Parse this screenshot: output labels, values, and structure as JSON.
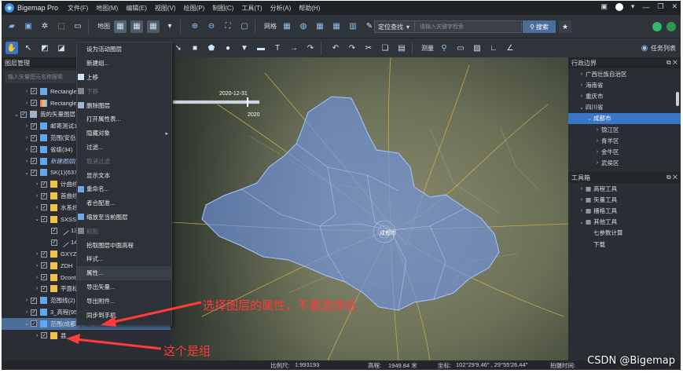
{
  "window": {
    "app_title": "Bigemap Pro",
    "menus": [
      "文件(F)",
      "地图(M)",
      "编辑(E)",
      "视图(V)",
      "绘图(P)",
      "制图(C)",
      "工具(T)",
      "分析(A)",
      "帮助(H)"
    ]
  },
  "toolbar": {
    "map_label": "地图",
    "grid_label": "网格",
    "search_mode": "定位查找",
    "search_placeholder": "请输入关键字检索",
    "search_button": "搜索",
    "measure_label": "测量",
    "task_list_label": "任务列表"
  },
  "layer_panel": {
    "title": "图层管理",
    "search_placeholder": "输入矢量图元名称搜索",
    "rows": [
      {
        "label": "Rectangle_",
        "indent": 1,
        "arrow": "›",
        "checked": true,
        "icon": "raster-icon"
      },
      {
        "label": "Rectangle_",
        "indent": 1,
        "arrow": "›",
        "checked": true,
        "icon": "raster-colored-icon"
      },
      {
        "label": "我的矢量图层",
        "indent": 0,
        "arrow": "⌄",
        "checked": true,
        "icon": "vector-group-icon"
      },
      {
        "label": "邮寄测试11",
        "indent": 1,
        "arrow": "›",
        "checked": true,
        "icon": "layer-stack-icon"
      },
      {
        "label": "范围(安岳县",
        "indent": 1,
        "arrow": "›",
        "checked": true,
        "icon": "layer-stack-icon"
      },
      {
        "label": "省级(34)",
        "indent": 1,
        "arrow": "›",
        "checked": true,
        "icon": "layer-stack-icon"
      },
      {
        "label": "新建图层(4)",
        "indent": 1,
        "arrow": "›",
        "checked": true,
        "icon": "layer-stack-icon",
        "italic": true
      },
      {
        "label": "SK(1)(637)",
        "indent": 1,
        "arrow": "⌄",
        "checked": true,
        "icon": "layer-stack-icon"
      },
      {
        "label": "计曲线",
        "indent": 2,
        "arrow": "›",
        "checked": true,
        "icon": "folder-icon"
      },
      {
        "label": "首曲线",
        "indent": 2,
        "arrow": "›",
        "checked": true,
        "icon": "folder-icon"
      },
      {
        "label": "水系线",
        "indent": 2,
        "arrow": "›",
        "checked": true,
        "icon": "folder-icon"
      },
      {
        "label": "SXSS",
        "indent": 2,
        "arrow": "⌄",
        "checked": true,
        "icon": "folder-icon"
      },
      {
        "label": "13",
        "indent": 3,
        "arrow": "",
        "checked": true,
        "icon": "line-icon"
      },
      {
        "label": "14",
        "indent": 3,
        "arrow": "",
        "checked": true,
        "icon": "line-icon"
      },
      {
        "label": "GXYZ",
        "indent": 2,
        "arrow": "›",
        "checked": true,
        "icon": "folder-icon"
      },
      {
        "label": "ZDH",
        "indent": 2,
        "arrow": "›",
        "checked": true,
        "icon": "folder-icon"
      },
      {
        "label": "Dconto",
        "indent": 2,
        "arrow": "›",
        "checked": true,
        "icon": "folder-icon"
      },
      {
        "label": "平面标调",
        "indent": 2,
        "arrow": "›",
        "checked": true,
        "icon": "folder-icon"
      },
      {
        "label": "范围线(2)",
        "indent": 1,
        "arrow": "›",
        "checked": true,
        "icon": "layer-stack-icon"
      },
      {
        "label": "3_高程(95)",
        "indent": 1,
        "arrow": "›",
        "checked": true,
        "icon": "layer-stack-icon"
      },
      {
        "label": "范围(成都市)(20)",
        "indent": 1,
        "arrow": "⌄",
        "checked": true,
        "icon": "layer-stack-icon",
        "selected": true
      },
      {
        "label": "县",
        "indent": 2,
        "arrow": "›",
        "checked": true,
        "icon": "folder-icon"
      }
    ]
  },
  "context_menu": {
    "items": [
      {
        "label": "设为活动图层",
        "disabled": false,
        "icon": ""
      },
      {
        "label": "新建组...",
        "disabled": false,
        "icon": ""
      },
      {
        "label": "上移",
        "disabled": false,
        "icon": "move-up-icon"
      },
      {
        "label": "下移",
        "disabled": true,
        "icon": "move-down-icon"
      },
      {
        "label": "删除图层",
        "disabled": false,
        "icon": "delete-icon"
      },
      {
        "label": "打开属性表...",
        "disabled": false,
        "icon": ""
      },
      {
        "label": "隐藏对象",
        "disabled": false,
        "icon": "",
        "submenu": true
      },
      {
        "label": "过滤...",
        "disabled": false,
        "icon": ""
      },
      {
        "label": "取消过滤",
        "disabled": true,
        "icon": ""
      },
      {
        "label": "显示文本",
        "disabled": false,
        "icon": ""
      },
      {
        "label": "重命名...",
        "disabled": false,
        "icon": "rename-icon"
      },
      {
        "label": "者合配准...",
        "disabled": false,
        "icon": ""
      },
      {
        "label": "缩放至当前图层",
        "disabled": false,
        "icon": "zoom-layer-icon"
      },
      {
        "label": "粘贴",
        "disabled": true,
        "icon": "paste-icon"
      },
      {
        "label": "拾取图层中面高程",
        "disabled": false,
        "icon": ""
      },
      {
        "label": "样式...",
        "disabled": false,
        "icon": ""
      },
      {
        "label": "属性...",
        "disabled": false,
        "icon": "",
        "highlighted": true
      },
      {
        "label": "导出矢量...",
        "disabled": false,
        "icon": ""
      },
      {
        "label": "导出附件...",
        "disabled": false,
        "icon": ""
      },
      {
        "label": "同步到手机",
        "disabled": false,
        "icon": ""
      }
    ]
  },
  "map": {
    "timeline_date": "2020-12-31",
    "timeline_year": "2020",
    "city_label": "成都市"
  },
  "admin_panel": {
    "title": "行政边界",
    "rows": [
      {
        "label": "广西壮族自治区",
        "indent": 1,
        "arrow": "›"
      },
      {
        "label": "海南省",
        "indent": 1,
        "arrow": "›"
      },
      {
        "label": "重庆市",
        "indent": 1,
        "arrow": "›"
      },
      {
        "label": "四川省",
        "indent": 1,
        "arrow": "⌄"
      },
      {
        "label": "成都市",
        "indent": 2,
        "arrow": "⌄",
        "selected": true
      },
      {
        "label": "锦江区",
        "indent": 3,
        "arrow": "›"
      },
      {
        "label": "青羊区",
        "indent": 3,
        "arrow": "›"
      },
      {
        "label": "金牛区",
        "indent": 3,
        "arrow": "›"
      },
      {
        "label": "武侯区",
        "indent": 3,
        "arrow": "›"
      }
    ]
  },
  "toolbox_panel": {
    "title": "工具箱",
    "rows": [
      {
        "label": "高程工具",
        "indent": 1,
        "arrow": "›"
      },
      {
        "label": "矢量工具",
        "indent": 1,
        "arrow": "›"
      },
      {
        "label": "栅格工具",
        "indent": 1,
        "arrow": "›"
      },
      {
        "label": "其他工具",
        "indent": 1,
        "arrow": "⌄"
      },
      {
        "label": "七参数计算",
        "indent": 2,
        "arrow": ""
      },
      {
        "label": "下载",
        "indent": 2,
        "arrow": ""
      }
    ]
  },
  "status_bar": {
    "scale_label": "比例尺:",
    "scale_value": "1:993193",
    "elevation_label": "高程:",
    "elevation_value": "1949.84 米",
    "coord_label": "坐标:",
    "coord_value": "102°29′9.46″ , 29°55′26.44″",
    "capture_label": "拍摄时间:"
  },
  "annotations": {
    "note1": "选择图层的属性，不要选择组",
    "note2": "这个是组"
  },
  "watermark": "CSDN @Bigemap",
  "colors": {
    "accent": "#3a76c8",
    "annotation_red": "#ff3b3b",
    "polygon_fill": "#6f95e6"
  }
}
